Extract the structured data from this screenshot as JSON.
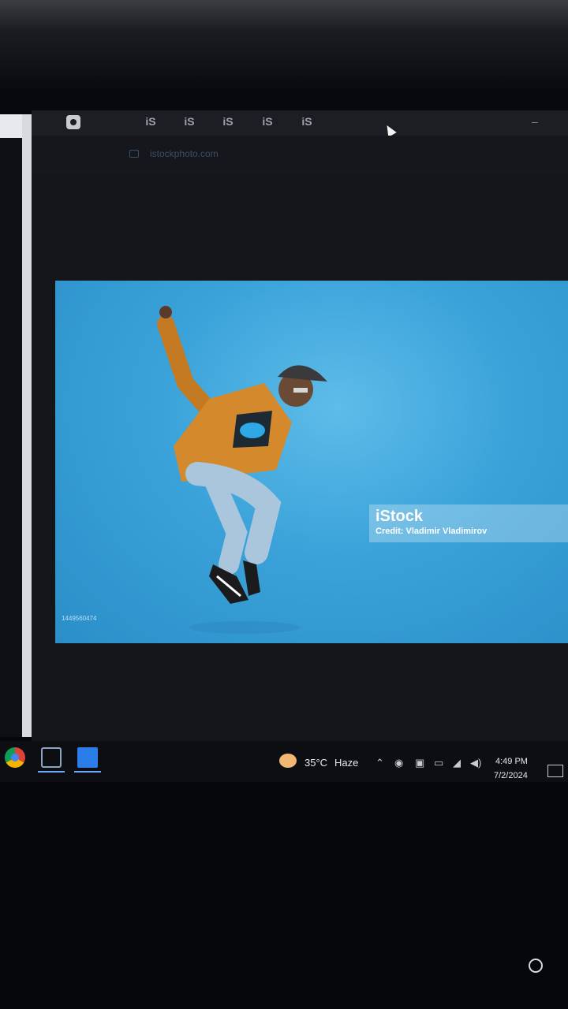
{
  "browser": {
    "tabs": [
      "iS",
      "iS",
      "iS",
      "iS",
      "iS"
    ],
    "url": "istockphoto.com"
  },
  "hero": {
    "watermark_logo": "iStock",
    "credit": "Credit: Vladimir Vladimirov",
    "small_mark": "1449560474",
    "background_color": "#3aa2d9"
  },
  "taskbar": {
    "weather_temp": "35°C",
    "weather_condition": "Haze",
    "time": "4:49 PM",
    "date": "7/2/2024",
    "tray_up_arrow": "⌃"
  },
  "icons": [
    "camera-icon",
    "cursor-icon",
    "chrome-icon",
    "tool-icon",
    "app-icon",
    "weather-icon",
    "network-icon",
    "volume-icon",
    "battery-icon",
    "notification-icon",
    "power-icon"
  ]
}
